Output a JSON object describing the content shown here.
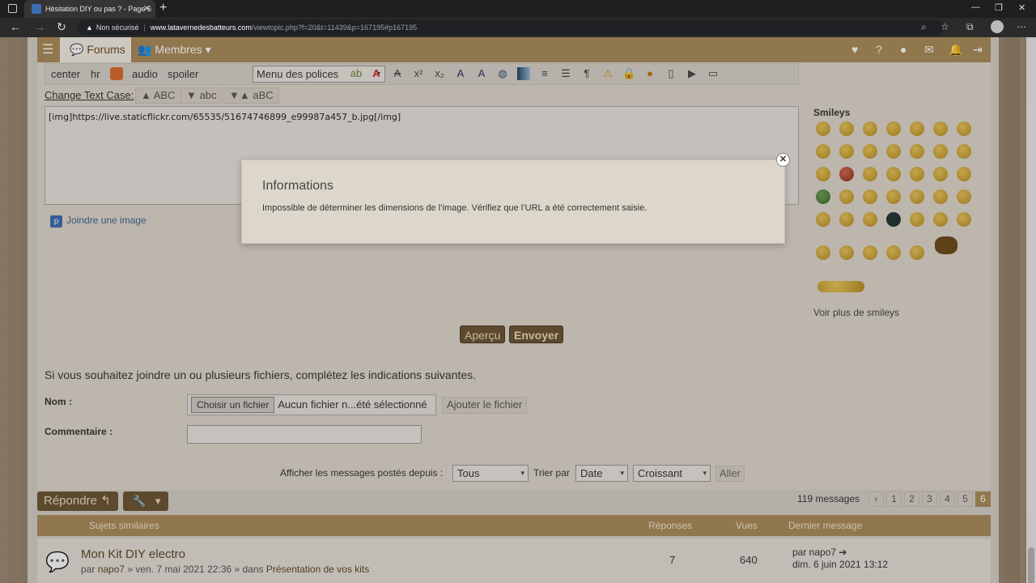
{
  "browser": {
    "tab_title": "Hésitation DIY ou pas ? - Page 6",
    "security_label": "Non sécurisé",
    "url_host": "www.latavernedesbatteurs.com",
    "url_path": "/viewtopic.php?f=20&t=11439&p=167195#p167195"
  },
  "nav": {
    "forums_label": "Forums",
    "members_label": "Membres"
  },
  "toolbar": {
    "center": "center",
    "hr": "hr",
    "audio": "audio",
    "spoiler": "spoiler",
    "font_menu": "Menu des polices",
    "change_case_label": "Change Text Case:",
    "upper": "▲ ABC",
    "lower": "▼ abc",
    "toggle": "▼▲ aBC"
  },
  "editor": {
    "content": "[img]https://live.staticflickr.com/65535/51674746899_e99987a457_b.jpg[/img]",
    "attach_image": "Joindre une image"
  },
  "smileys": {
    "title": "Smileys",
    "more": "Voir plus de smileys"
  },
  "actions": {
    "preview": "Aperçu",
    "submit": "Envoyer"
  },
  "attachments": {
    "intro": "Si vous souhaitez joindre un ou plusieurs fichiers, complétez les indications suivantes.",
    "name_label": "Nom :",
    "choose_file": "Choisir un fichier",
    "no_file": "Aucun fichier n...été sélectionné",
    "add_file": "Ajouter le fichier",
    "comment_label": "Commentaire :"
  },
  "filters": {
    "show_since_label": "Afficher les messages postés depuis :",
    "show_since_value": "Tous",
    "sort_by_label": "Trier par",
    "sort_by_value": "Date",
    "order_value": "Croissant",
    "go": "Aller"
  },
  "pagination": {
    "reply": "Répondre",
    "message_count": "119 messages",
    "pages": [
      "1",
      "2",
      "3",
      "4",
      "5",
      "6"
    ],
    "current_page": "6"
  },
  "similar": {
    "heading": "Sujets similaires",
    "col_replies": "Réponses",
    "col_views": "Vues",
    "col_last": "Dernier message",
    "rows": [
      {
        "title": "Mon Kit DIY electro",
        "by": "par",
        "author": "napo7",
        "date": "» ven. 7 mai 2021 22:36 » dans",
        "forum": "Présentation de vos kits",
        "replies": "7",
        "views": "640",
        "last_by": "par napo7",
        "last_date": "dim. 6 juin 2021 13:12"
      }
    ]
  },
  "modal": {
    "title": "Informations",
    "message": "Impossible de déterminer les dimensions de l’image. Vérifiez que l’URL a été correctement saisie."
  }
}
